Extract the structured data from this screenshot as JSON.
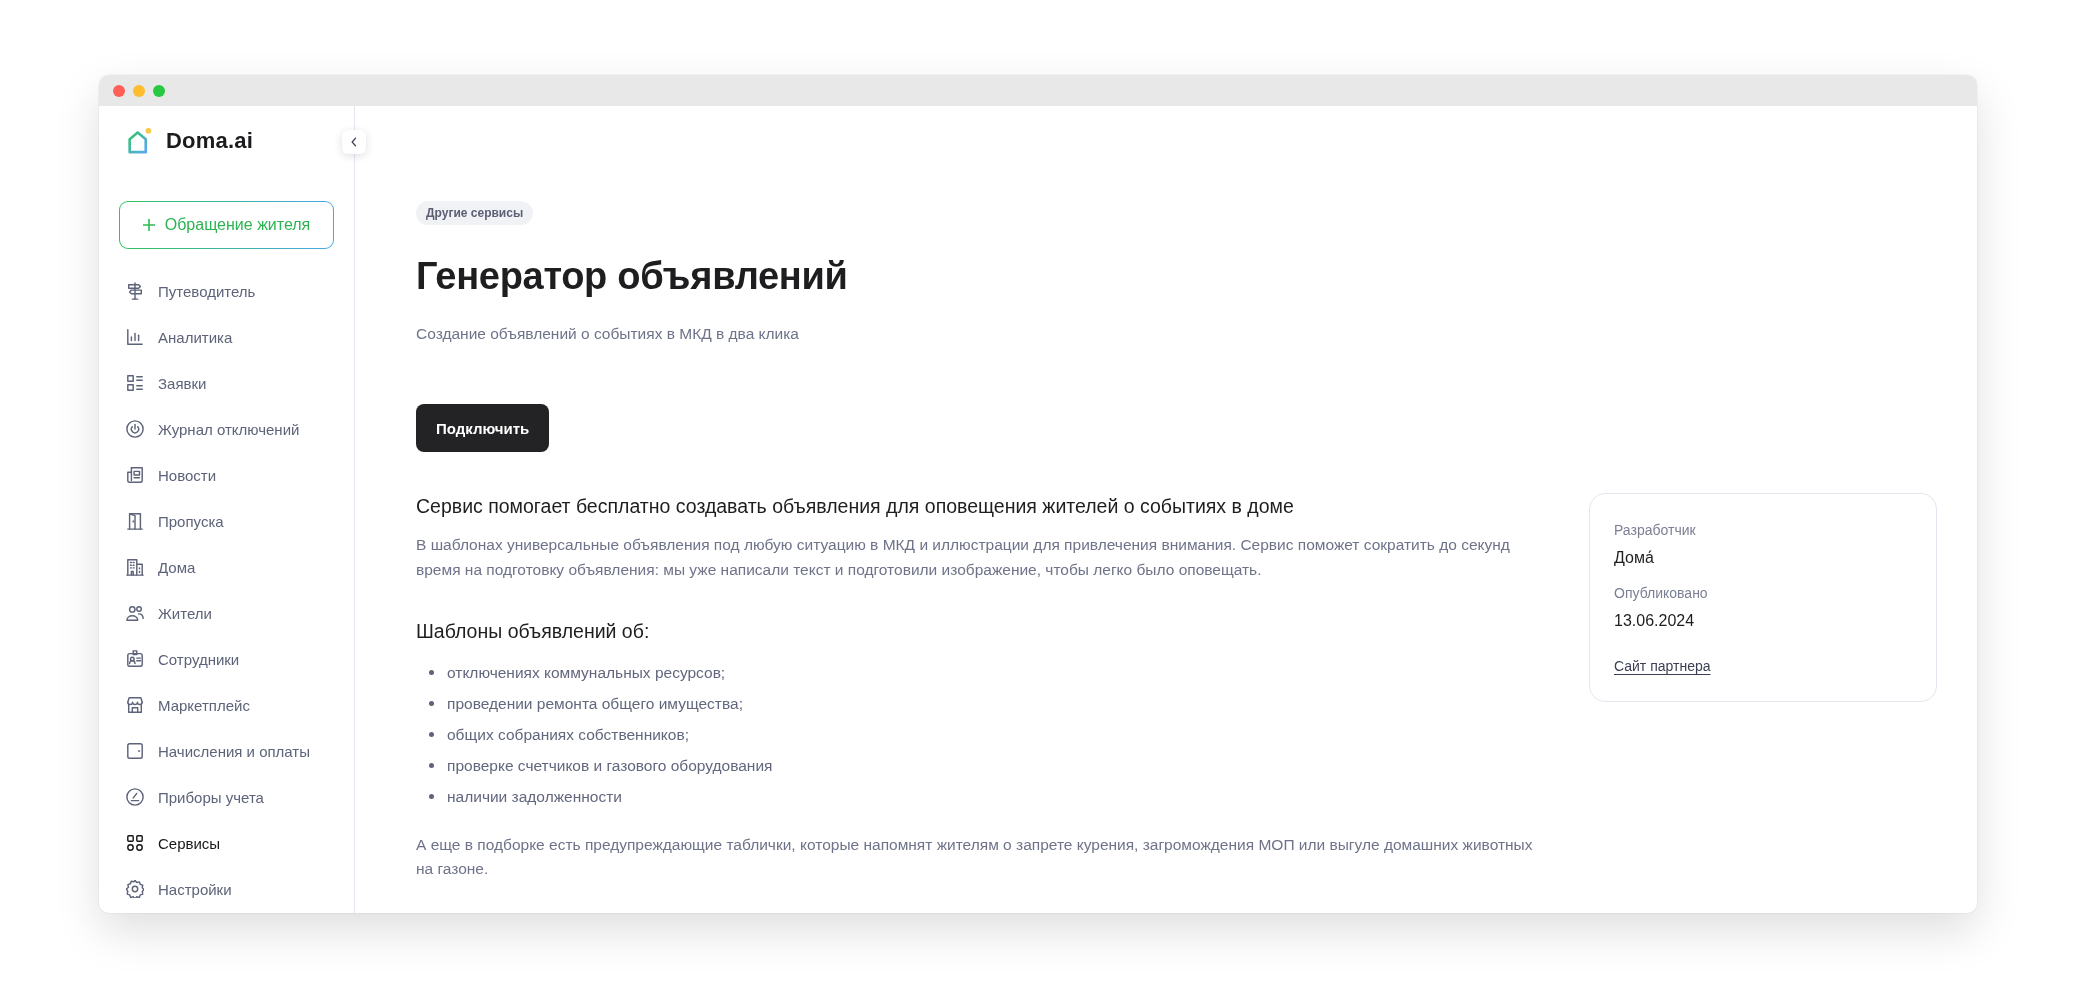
{
  "sidebar": {
    "logo": "Doma.ai",
    "new_request_button": "Обращение жителя",
    "items": [
      {
        "label": "Путеводитель",
        "selected": false
      },
      {
        "label": "Аналитика",
        "selected": false
      },
      {
        "label": "Заявки",
        "selected": false
      },
      {
        "label": "Журнал отключений",
        "selected": false
      },
      {
        "label": "Новости",
        "selected": false
      },
      {
        "label": "Пропуска",
        "selected": false
      },
      {
        "label": "Дома",
        "selected": false
      },
      {
        "label": "Жители",
        "selected": false
      },
      {
        "label": "Сотрудники",
        "selected": false
      },
      {
        "label": "Маркетплейс",
        "selected": false
      },
      {
        "label": "Начисления и оплаты",
        "selected": false
      },
      {
        "label": "Приборы учета",
        "selected": false
      },
      {
        "label": "Сервисы",
        "selected": true
      },
      {
        "label": "Настройки",
        "selected": false
      }
    ]
  },
  "main": {
    "tag": "Другие сервисы",
    "title": "Генератор объявлений",
    "subtitle": "Создание объявлений о событиях в МКД в два клика",
    "connect_button": "Подключить",
    "heading": "Сервис помогает бесплатно создавать объявления для оповещения жителей о событиях в доме",
    "description": "В шаблонах универсальные объявления под любую ситуацию в МКД и иллюстрации для привлечения внимания. Сервис поможет сократить до секунд время на подготовку объявления: мы уже написали текст и подготовили изображение, чтобы легко было оповещать.",
    "templates_heading": "Шаблоны объявлений об:",
    "templates": [
      "отключениях коммунальных ресурсов;",
      "проведении ремонта общего имущества;",
      "общих собраниях собственников;",
      "проверке счетчиков и газового оборудования",
      "наличии задолженности"
    ],
    "footnote": "А еще в подборке есть предупреждающие таблички, которые напомнят жителям о запрете курения, загромождения МОП или выгуле домашних животных на газоне."
  },
  "info_card": {
    "fields": [
      {
        "label": "Разработчик",
        "value": "Дома́"
      },
      {
        "label": "Опубликовано",
        "value": "13.06.2024"
      }
    ],
    "link": "Сайт партнера"
  }
}
